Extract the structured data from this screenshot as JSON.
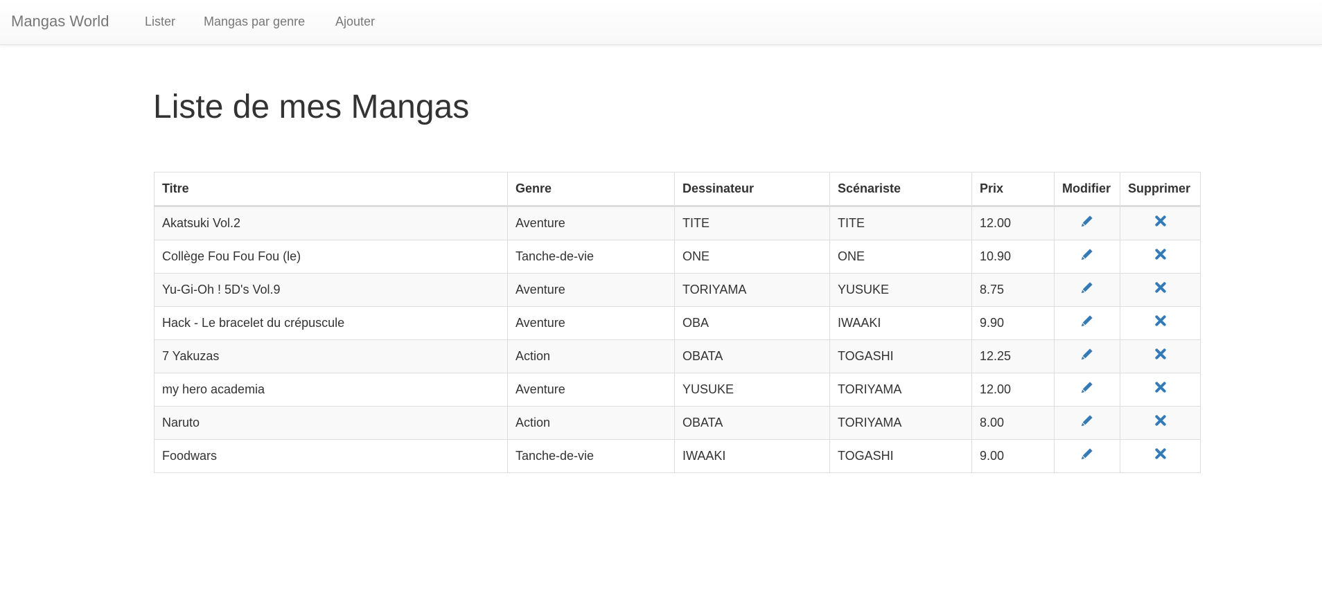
{
  "navbar": {
    "brand": "Mangas World",
    "links": [
      "Lister",
      "Mangas par genre",
      "Ajouter"
    ]
  },
  "page": {
    "title": "Liste de mes Mangas"
  },
  "table": {
    "headers": {
      "titre": "Titre",
      "genre": "Genre",
      "dessinateur": "Dessinateur",
      "scenariste": "Scénariste",
      "prix": "Prix",
      "modifier": "Modifier",
      "supprimer": "Supprimer"
    },
    "rows": [
      {
        "titre": "Akatsuki Vol.2",
        "genre": "Aventure",
        "dessinateur": "TITE",
        "scenariste": "TITE",
        "prix": "12.00"
      },
      {
        "titre": "Collège Fou Fou Fou (le)",
        "genre": "Tanche-de-vie",
        "dessinateur": "ONE",
        "scenariste": "ONE",
        "prix": "10.90"
      },
      {
        "titre": "Yu-Gi-Oh ! 5D's Vol.9",
        "genre": "Aventure",
        "dessinateur": "TORIYAMA",
        "scenariste": "YUSUKE",
        "prix": "8.75"
      },
      {
        "titre": "Hack - Le bracelet du crépuscule",
        "genre": "Aventure",
        "dessinateur": "OBA",
        "scenariste": "IWAAKI",
        "prix": "9.90"
      },
      {
        "titre": "7 Yakuzas",
        "genre": "Action",
        "dessinateur": "OBATA",
        "scenariste": "TOGASHI",
        "prix": "12.25"
      },
      {
        "titre": "my hero academia",
        "genre": "Aventure",
        "dessinateur": "YUSUKE",
        "scenariste": "TORIYAMA",
        "prix": "12.00"
      },
      {
        "titre": "Naruto",
        "genre": "Action",
        "dessinateur": "OBATA",
        "scenariste": "TORIYAMA",
        "prix": "8.00"
      },
      {
        "titre": "Foodwars",
        "genre": "Tanche-de-vie",
        "dessinateur": "IWAAKI",
        "scenariste": "TOGASHI",
        "prix": "9.00"
      }
    ],
    "icons": {
      "modifier": "pencil-icon",
      "supprimer": "remove-icon"
    }
  },
  "colors": {
    "link_icon": "#337ab7",
    "nav_text": "#777777",
    "text": "#333333",
    "border": "#dddddd",
    "stripe": "#f9f9f9"
  }
}
